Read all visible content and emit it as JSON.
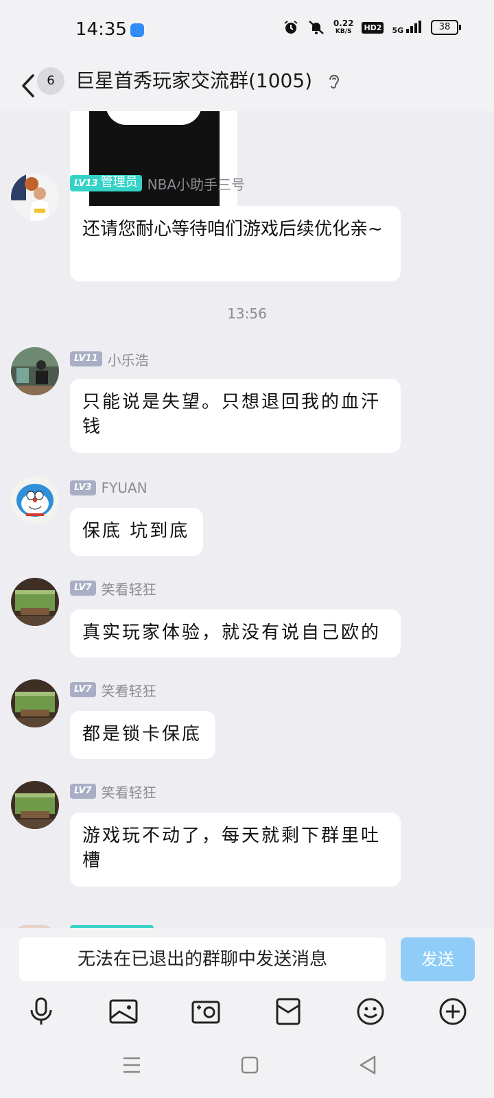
{
  "status_bar": {
    "time": "14:35",
    "net_speed_top": "0.22",
    "net_speed_unit": "KB/S",
    "hd": "HD2",
    "signal": "5G",
    "battery": "38"
  },
  "header": {
    "unread_count": "6",
    "title": "巨星首秀玩家交流群(1005)"
  },
  "messages": [
    {
      "level": "LV13",
      "role": "管理员",
      "nick": "NBA小助手三号",
      "text": "还请您耐心等待咱们游戏后续优化亲~"
    },
    {
      "level": "LV11",
      "nick": "小乐浩",
      "text": "只能说是失望。只想退回我的血汗钱"
    },
    {
      "level": "LV3",
      "nick": "FYUAN",
      "text": "保底 坑到底"
    },
    {
      "level": "LV7",
      "nick": "笑看轻狂",
      "text": "真实玩家体验，就没有说自己欧的"
    },
    {
      "level": "LV7",
      "nick": "笑看轻狂",
      "text": "都是锁卡保底"
    },
    {
      "level": "LV7",
      "nick": "笑看轻狂",
      "text": "游戏玩不动了，每天就剩下群里吐槽"
    }
  ],
  "time_separator": "13:56",
  "input": {
    "placeholder": "无法在已退出的群聊中发送消息",
    "send_label": "发送"
  },
  "toolbar_icons": [
    "microphone-icon",
    "image-icon",
    "camera-icon",
    "red-packet-icon",
    "emoji-icon",
    "plus-icon"
  ],
  "nav_icons": [
    "menu-icon",
    "home-icon",
    "back-triangle-icon"
  ]
}
